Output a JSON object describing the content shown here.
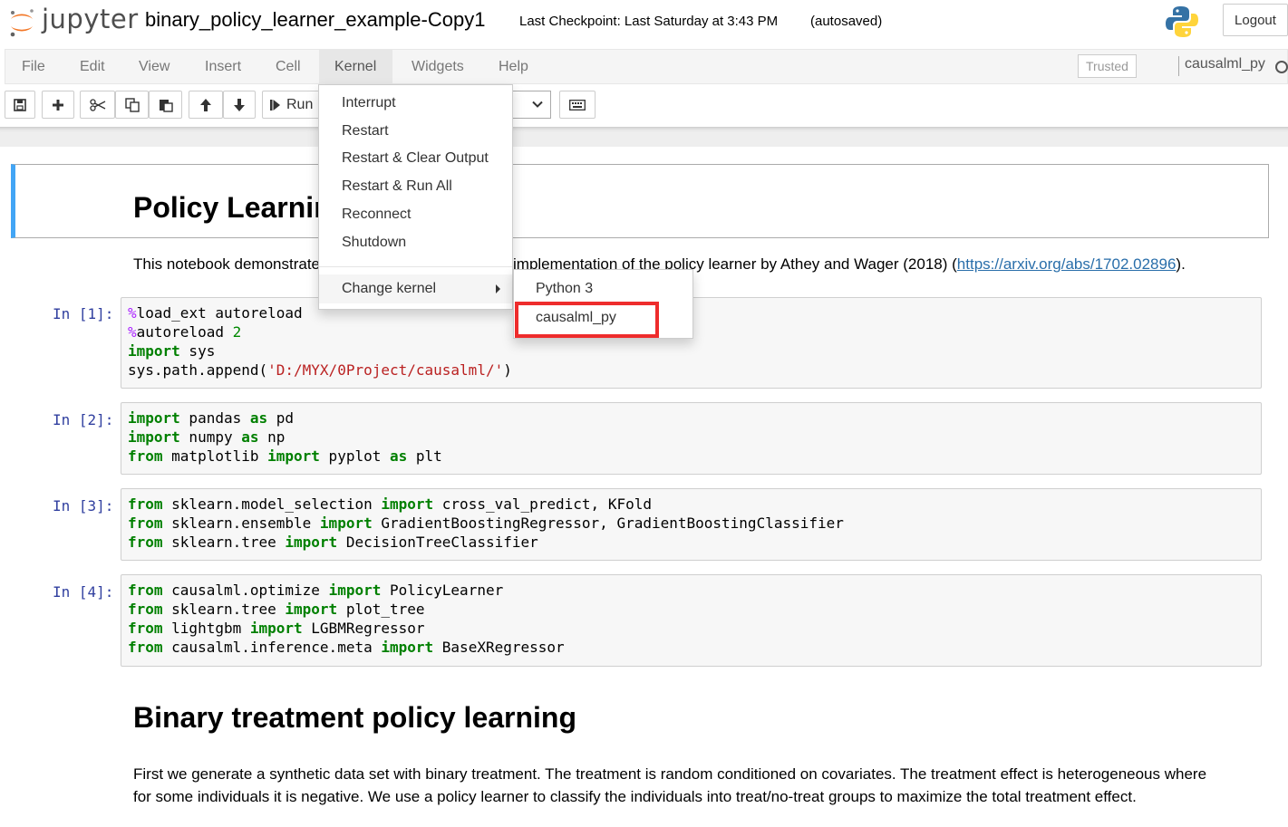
{
  "header": {
    "logo_text": "jupyter",
    "notebook_name": "binary_policy_learner_example-Copy1",
    "checkpoint": "Last Checkpoint: Last Saturday at 3:43 PM",
    "autosaved": "(autosaved)",
    "logout_label": "Logout"
  },
  "menubar": {
    "items": [
      "File",
      "Edit",
      "View",
      "Insert",
      "Cell",
      "Kernel",
      "Widgets",
      "Help"
    ],
    "trusted_label": "Trusted",
    "kernel_name": "causalml_py"
  },
  "toolbar": {
    "run_label": "Run"
  },
  "kernel_menu": {
    "items": [
      "Interrupt",
      "Restart",
      "Restart & Clear Output",
      "Restart & Run All",
      "Reconnect",
      "Shutdown"
    ],
    "change_kernel_label": "Change kernel",
    "submenu": [
      "Python 3",
      "causalml_py"
    ]
  },
  "notebook": {
    "title_heading": "Policy Learning",
    "intro_left": "This notebook demonstrate",
    "intro_right": "implementation of the policy learner by Athey and Wager (2018) (",
    "intro_link": "https://arxiv.org/abs/1702.02896",
    "intro_end": ").",
    "cells": [
      {
        "prompt": "In [1]:"
      },
      {
        "prompt": "In [2]:"
      },
      {
        "prompt": "In [3]:"
      },
      {
        "prompt": "In [4]:"
      }
    ],
    "section_heading": "Binary treatment policy learning",
    "section_para_1": "First we generate a synthetic data set with binary treatment. The treatment is random conditioned on covariates. The treatment effect is heterogeneous where",
    "section_para_2": "for some individuals it is negative. We use a policy learner to classify the individuals into treat/no-treat groups to maximize the total treatment effect."
  },
  "code": {
    "c1": [
      "%load_ext autoreload",
      "%autoreload 2",
      "import sys",
      "sys.path.append('D:/MYX/0Project/causalml/')"
    ],
    "c2": [
      "import pandas as pd",
      "import numpy as np",
      "from matplotlib import pyplot as plt"
    ],
    "c3": [
      "from sklearn.model_selection import cross_val_predict, KFold",
      "from sklearn.ensemble import GradientBoostingRegressor, GradientBoostingClassifier",
      "from sklearn.tree import DecisionTreeClassifier"
    ],
    "c4": [
      "from causalml.optimize import PolicyLearner",
      "from sklearn.tree import plot_tree",
      "from lightgbm import LGBMRegressor",
      "from causalml.inference.meta import BaseXRegressor"
    ]
  },
  "icons": [
    "jupyter-logo-icon",
    "python-logo-icon",
    "save-icon",
    "plus-icon",
    "scissors-icon",
    "copy-icon",
    "paste-icon",
    "arrow-up-icon",
    "arrow-down-icon",
    "step-forward-icon",
    "chevron-down-icon",
    "keyboard-icon",
    "caret-right-icon",
    "kernel-idle-icon"
  ],
  "colors": {
    "selected_cell_border": "#42a5f5",
    "highlight_box": "#ee2c2c",
    "prompt": "#303f9f",
    "keyword": "#008000",
    "link": "#296eaa"
  }
}
